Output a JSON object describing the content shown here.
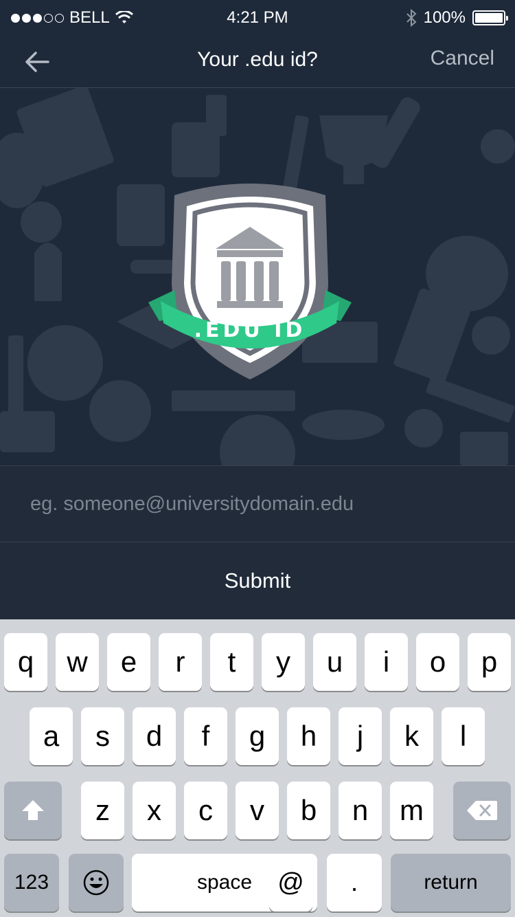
{
  "status_bar": {
    "carrier": "BELL",
    "time": "4:21 PM",
    "battery": "100%"
  },
  "nav": {
    "title": "Your .edu id?",
    "cancel_label": "Cancel"
  },
  "badge": {
    "label": ".EDU ID"
  },
  "form": {
    "email_placeholder": "eg. someone@universitydomain.edu",
    "submit_label": "Submit"
  },
  "keyboard": {
    "row1": [
      "q",
      "w",
      "e",
      "r",
      "t",
      "y",
      "u",
      "i",
      "o",
      "p"
    ],
    "row2": [
      "a",
      "s",
      "d",
      "f",
      "g",
      "h",
      "j",
      "k",
      "l"
    ],
    "row3": [
      "z",
      "x",
      "c",
      "v",
      "b",
      "n",
      "m"
    ],
    "numbers_label": "123",
    "space_label": "space",
    "at_label": "@",
    "dot_label": ".",
    "return_label": "return"
  },
  "colors": {
    "background": "#1e2a3a",
    "accent_green": "#2fc98a",
    "badge_grey": "#6d717c",
    "keyboard_bg": "#d1d4d9"
  }
}
